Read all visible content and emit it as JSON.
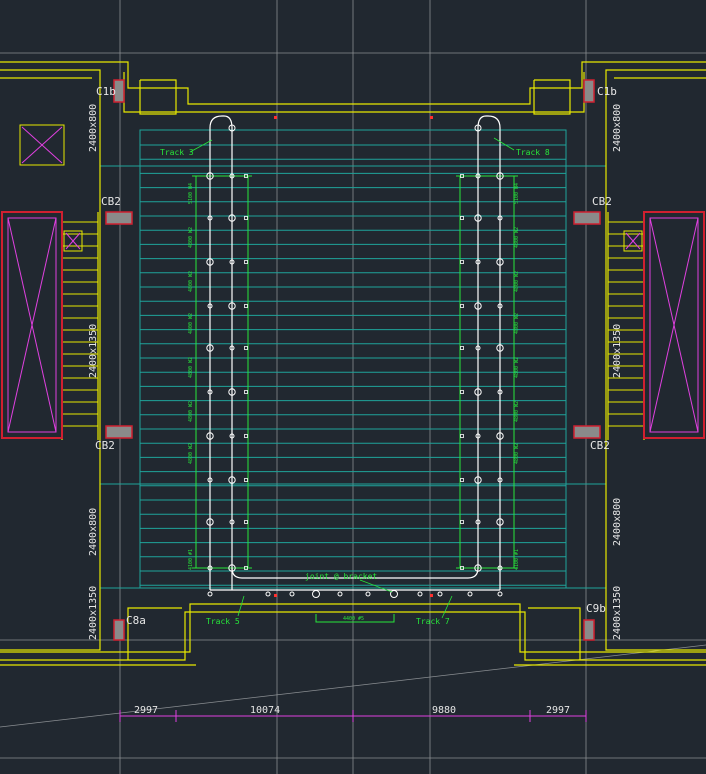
{
  "labels": {
    "c1b_left": "C1b",
    "c1b_right": "C1b",
    "cb2_tl": "CB2",
    "cb2_tr": "CB2",
    "cb2_bl": "CB2",
    "cb2_br": "CB2",
    "c8a": "C8a",
    "c9b": "C9b",
    "wall_left_1": "2400x800",
    "wall_left_2": "2400x1350",
    "wall_left_3": "2400x800",
    "wall_left_4": "2400x1350",
    "wall_right_1": "2400x800",
    "wall_right_2": "2400x1350",
    "wall_right_3": "2400x800",
    "wall_right_4": "2400x1350"
  },
  "tracks": {
    "track3": "Track 3",
    "track8": "Track 8",
    "track5": "Track 5",
    "track7": "Track 7",
    "joint": "joint @ bracket",
    "bottom_span": "4400 #5"
  },
  "left_spans": [
    "5100 W4",
    "4800 W2",
    "4800 W2",
    "4800 W2",
    "4800 W2",
    "4800 W2",
    "4800 W2",
    "4100 #1"
  ],
  "right_spans": [
    "5100 W4",
    "4800 W2",
    "4800 W2",
    "4800 W2",
    "4800 W2",
    "4800 W2",
    "4800 W2",
    "4100 #1"
  ],
  "dimensions": [
    "2997",
    "10074",
    "9880",
    "2997"
  ],
  "colors": {
    "background": "#212830",
    "wall": "#e8e800",
    "track": "#27e63a",
    "rail": "#ffffff",
    "dimension": "#e040e0",
    "grid": "#8a8e92",
    "column": "#d02030",
    "panel": "#1fa39a"
  }
}
